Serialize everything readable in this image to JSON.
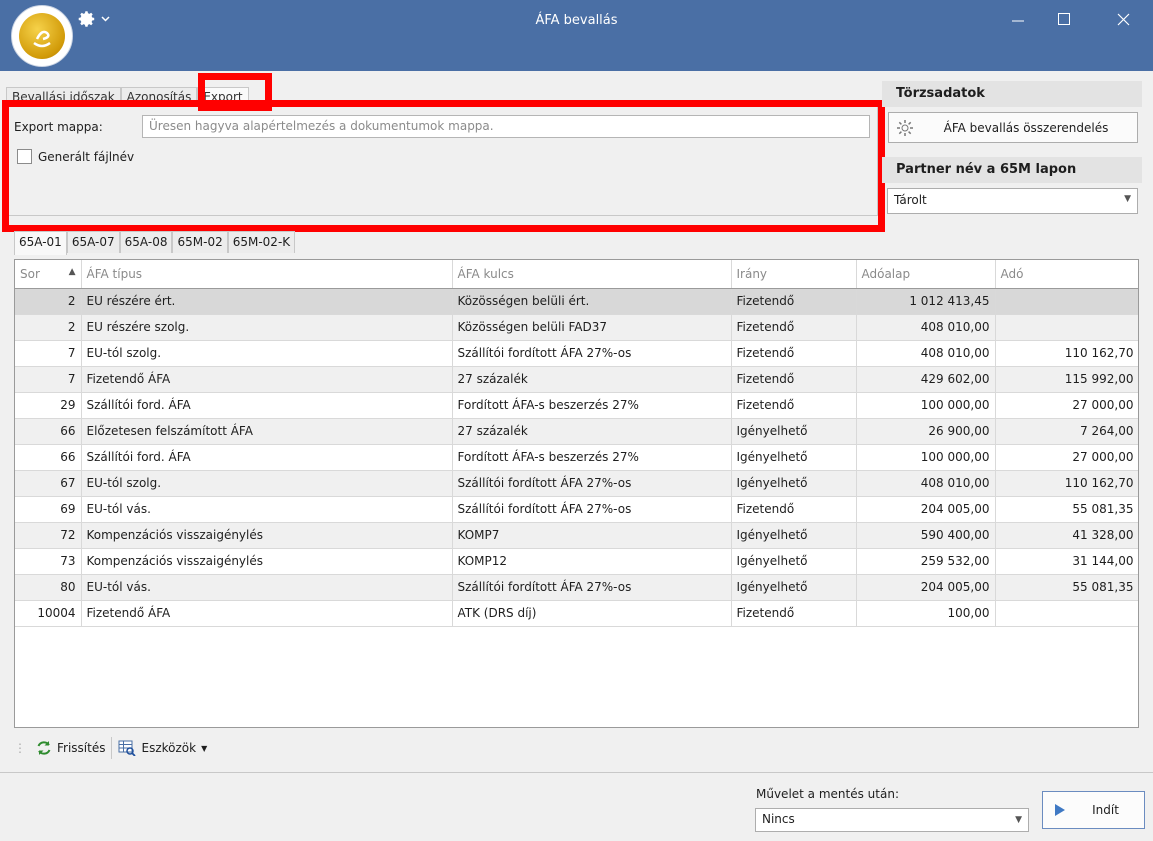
{
  "window": {
    "title": "ÁFA bevallás",
    "colors": {
      "titlebar": "#4a6fa5",
      "highlight": "#ff0000"
    },
    "controls": {
      "minimize": "minimize-icon",
      "maximize": "maximize-icon",
      "close": "close-icon"
    }
  },
  "top_tabs": [
    {
      "label": "Bevallási időszak"
    },
    {
      "label": "Azonosítás"
    },
    {
      "label": "Export",
      "active": true
    }
  ],
  "export": {
    "folder_label": "Export mappa:",
    "folder_placeholder": "Üresen hagyva alapértelmezés a dokumentumok mappa.",
    "generated_filename_label": "Generált fájlnév",
    "generated_filename_checked": false
  },
  "right_panel": {
    "torzsadatok_header": "Törzsadatok",
    "mapping_button": "ÁFA bevallás összerendelés",
    "partner_header": "Partner név a 65M lapon",
    "partner_select": "Tárolt"
  },
  "grid_tabs": [
    "65A-01",
    "65A-07",
    "65A-08",
    "65M-02",
    "65M-02-K"
  ],
  "grid": {
    "columns": [
      "Sor",
      "ÁFA típus",
      "ÁFA kulcs",
      "Irány",
      "Adóalap",
      "Adó"
    ],
    "rows": [
      [
        "2",
        "EU részére ért.",
        "Közösségen belüli ért.",
        "Fizetendő",
        "1 012 413,45",
        ""
      ],
      [
        "2",
        "EU részére szolg.",
        "Közösségen belüli FAD37",
        "Fizetendő",
        "408 010,00",
        ""
      ],
      [
        "7",
        "EU-tól szolg.",
        "Szállítói fordított ÁFA 27%-os",
        "Fizetendő",
        "408 010,00",
        "110 162,70"
      ],
      [
        "7",
        "Fizetendő ÁFA",
        "27 százalék",
        "Fizetendő",
        "429 602,00",
        "115 992,00"
      ],
      [
        "29",
        "Szállítói ford. ÁFA",
        "Fordított ÁFA-s beszerzés 27%",
        "Fizetendő",
        "100 000,00",
        "27 000,00"
      ],
      [
        "66",
        "Előzetesen felszámított ÁFA",
        "27 százalék",
        "Igényelhető",
        "26 900,00",
        "7 264,00"
      ],
      [
        "66",
        "Szállítói ford. ÁFA",
        "Fordított ÁFA-s beszerzés 27%",
        "Igényelhető",
        "100 000,00",
        "27 000,00"
      ],
      [
        "67",
        "EU-tól szolg.",
        "Szállítói fordított ÁFA 27%-os",
        "Igényelhető",
        "408 010,00",
        "110 162,70"
      ],
      [
        "69",
        "EU-tól vás.",
        "Szállítói fordított ÁFA 27%-os",
        "Fizetendő",
        "204 005,00",
        "55 081,35"
      ],
      [
        "72",
        "Kompenzációs visszaigénylés",
        "KOMP7",
        "Igényelhető",
        "590 400,00",
        "41 328,00"
      ],
      [
        "73",
        "Kompenzációs visszaigénylés",
        "KOMP12",
        "Igényelhető",
        "259 532,00",
        "31 144,00"
      ],
      [
        "80",
        "EU-tól vás.",
        "Szállítói fordított ÁFA 27%-os",
        "Igényelhető",
        "204 005,00",
        "55 081,35"
      ],
      [
        "10004",
        "Fizetendő ÁFA",
        "ATK (DRS díj)",
        "Fizetendő",
        "100,00",
        ""
      ]
    ]
  },
  "toolbar": {
    "refresh_label": "Frissítés",
    "tools_label": "Eszközök"
  },
  "footer": {
    "after_save_label": "Művelet a mentés után:",
    "after_save_value": "Nincs",
    "start_button": "Indít"
  }
}
